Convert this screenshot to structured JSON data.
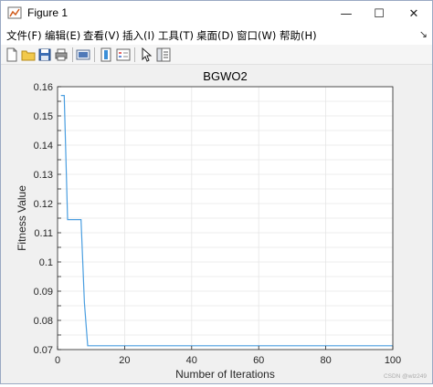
{
  "window": {
    "title": "Figure 1",
    "minimize_glyph": "—",
    "maximize_glyph": "☐",
    "close_glyph": "✕"
  },
  "menubar": {
    "items": [
      "文件(F)",
      "编辑(E)",
      "查看(V)",
      "插入(I)",
      "工具(T)",
      "桌面(D)",
      "窗口(W)",
      "帮助(H)"
    ],
    "dock_glyph": "↘"
  },
  "toolbar": {
    "icons": [
      "new-figure-icon",
      "open-file-icon",
      "save-icon",
      "print-icon",
      "link-plot-icon",
      "colorbar-icon",
      "legend-icon",
      "edit-plot-arrow-icon",
      "property-inspector-icon"
    ]
  },
  "watermark": "CSDN @wlz249",
  "chart_data": {
    "type": "line",
    "title": "BGWO2",
    "xlabel": "Number of Iterations",
    "ylabel": "Fitness Value",
    "xlim": [
      0,
      100
    ],
    "ylim": [
      0.07,
      0.16
    ],
    "x_ticks": [
      "0",
      "20",
      "40",
      "60",
      "80",
      "100"
    ],
    "y_ticks": [
      "0.07",
      "0.075",
      "0.08",
      "0.085",
      "0.09",
      "0.095",
      "0.1",
      "0.105",
      "0.11",
      "0.115",
      "0.12",
      "0.125",
      "0.13",
      "0.135",
      "0.14",
      "0.145",
      "0.15",
      "0.155",
      "0.16"
    ],
    "y_tick_labels_shown": [
      "0.07",
      "0.08",
      "0.09",
      "0.1",
      "0.11",
      "0.12",
      "0.13",
      "0.14",
      "0.15",
      "0.16"
    ],
    "grid": true,
    "line_color": "#4a9ee0",
    "series": [
      {
        "x": [
          1,
          2,
          3,
          4,
          5,
          6,
          7,
          8,
          9,
          10,
          100
        ],
        "y": [
          0.157,
          0.157,
          0.1145,
          0.1145,
          0.1145,
          0.1145,
          0.1145,
          0.086,
          0.0713,
          0.0713,
          0.0713
        ]
      }
    ]
  }
}
